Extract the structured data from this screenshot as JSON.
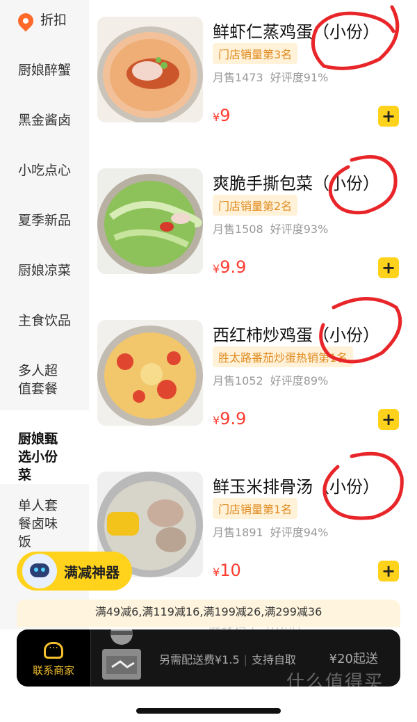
{
  "sidebar": {
    "discount_label": "折扣",
    "items": [
      {
        "label": "厨娘醉蟹"
      },
      {
        "label": "黑金酱卤"
      },
      {
        "label": "小吃点心"
      },
      {
        "label": "夏季新品"
      },
      {
        "label": "厨娘凉菜"
      },
      {
        "label": "主食饮品"
      },
      {
        "label": "多人超值套餐"
      },
      {
        "label": "厨娘甄选小份菜",
        "active": true
      },
      {
        "label": "单人套餐卤味饭"
      }
    ]
  },
  "products": [
    {
      "name": "鲜虾仁蒸鸡蛋（小份）",
      "badge": "门店销量第3名",
      "monthly": "月售1473",
      "rating": "好评度91%",
      "currency": "¥",
      "price": "9"
    },
    {
      "name": "爽脆手撕包菜（小份）",
      "badge": "门店销量第2名",
      "monthly": "月售1508",
      "rating": "好评度93%",
      "currency": "¥",
      "price": "9.9"
    },
    {
      "name": "西红柿炒鸡蛋（小份）",
      "badge": "胜太路番茄炒蛋热销第1名",
      "monthly": "月售1052",
      "rating": "好评度89%",
      "currency": "¥",
      "price": "9.9"
    },
    {
      "name": "鲜玉米排骨汤（小份）",
      "badge": "门店销量第1名",
      "monthly": "月售1891",
      "rating": "好评度94%",
      "currency": "¥",
      "price": "10"
    }
  ],
  "add_symbol": "+",
  "promo": {
    "label": "满减神器"
  },
  "discounts": "满49减6,满119减16,满199减26,满299减36",
  "behind_text": "麻辣鸡丁（小份）",
  "bottom_bar": {
    "contact_label": "联系商家",
    "delivery_fee": "另需配送费¥1.5",
    "pickup": "支持自取",
    "minimum": "¥20起送"
  },
  "watermark": "什么值得买",
  "colors": {
    "accent": "#ffd21c",
    "price": "#ff3b30",
    "badge_text": "#e08a1f",
    "badge_bg": "#fff2d9"
  }
}
